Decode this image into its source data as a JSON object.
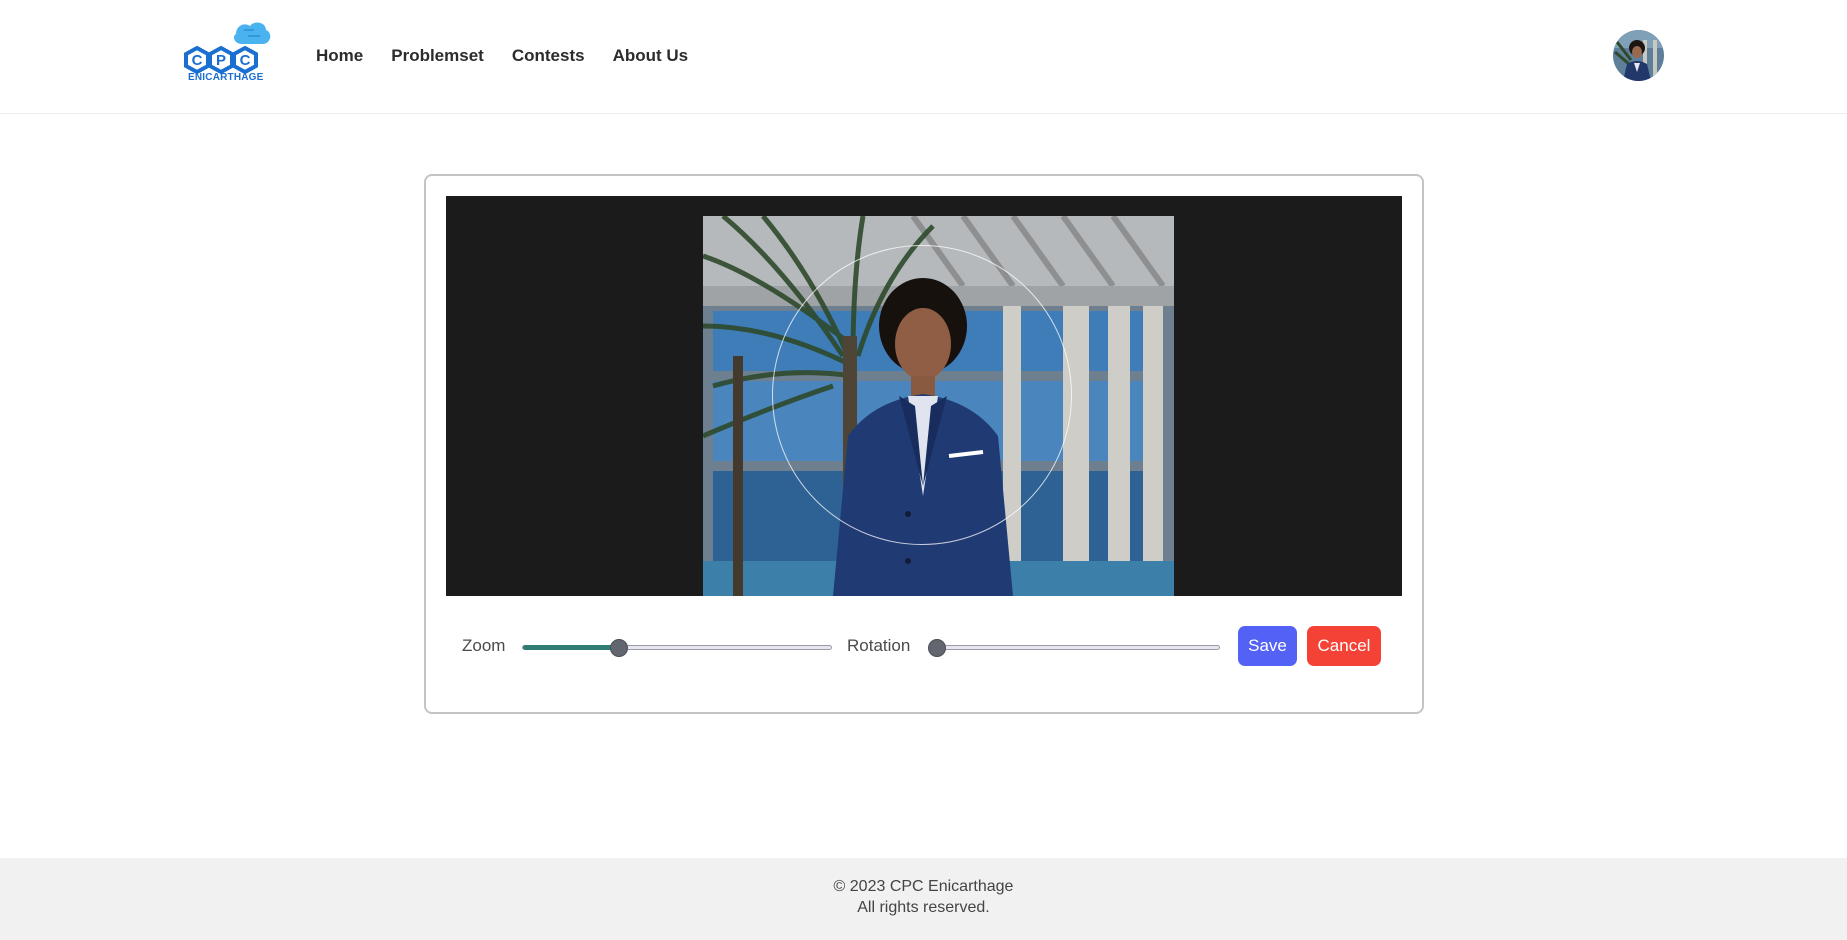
{
  "brand": {
    "logo_letters": "CPC",
    "logo_caption": "ENICARTHAGE",
    "colors": {
      "primary": "#1a6fd1",
      "accent": "#4ab3ef"
    }
  },
  "nav": {
    "items": [
      {
        "label": "Home"
      },
      {
        "label": "Problemset"
      },
      {
        "label": "Contests"
      },
      {
        "label": "About Us"
      }
    ]
  },
  "user": {
    "avatar_icon": "user-avatar"
  },
  "cropper": {
    "zoom": {
      "label": "Zoom",
      "value_fraction": 0.31
    },
    "rotation": {
      "label": "Rotation",
      "value_fraction": 0.0
    },
    "actions": {
      "save_label": "Save",
      "cancel_label": "Cancel",
      "save_color": "#5461f5",
      "cancel_color": "#f44336"
    },
    "slider_fill_color": "#2f7d74"
  },
  "footer": {
    "line1": "© 2023 CPC Enicarthage",
    "line2": "All rights reserved."
  }
}
